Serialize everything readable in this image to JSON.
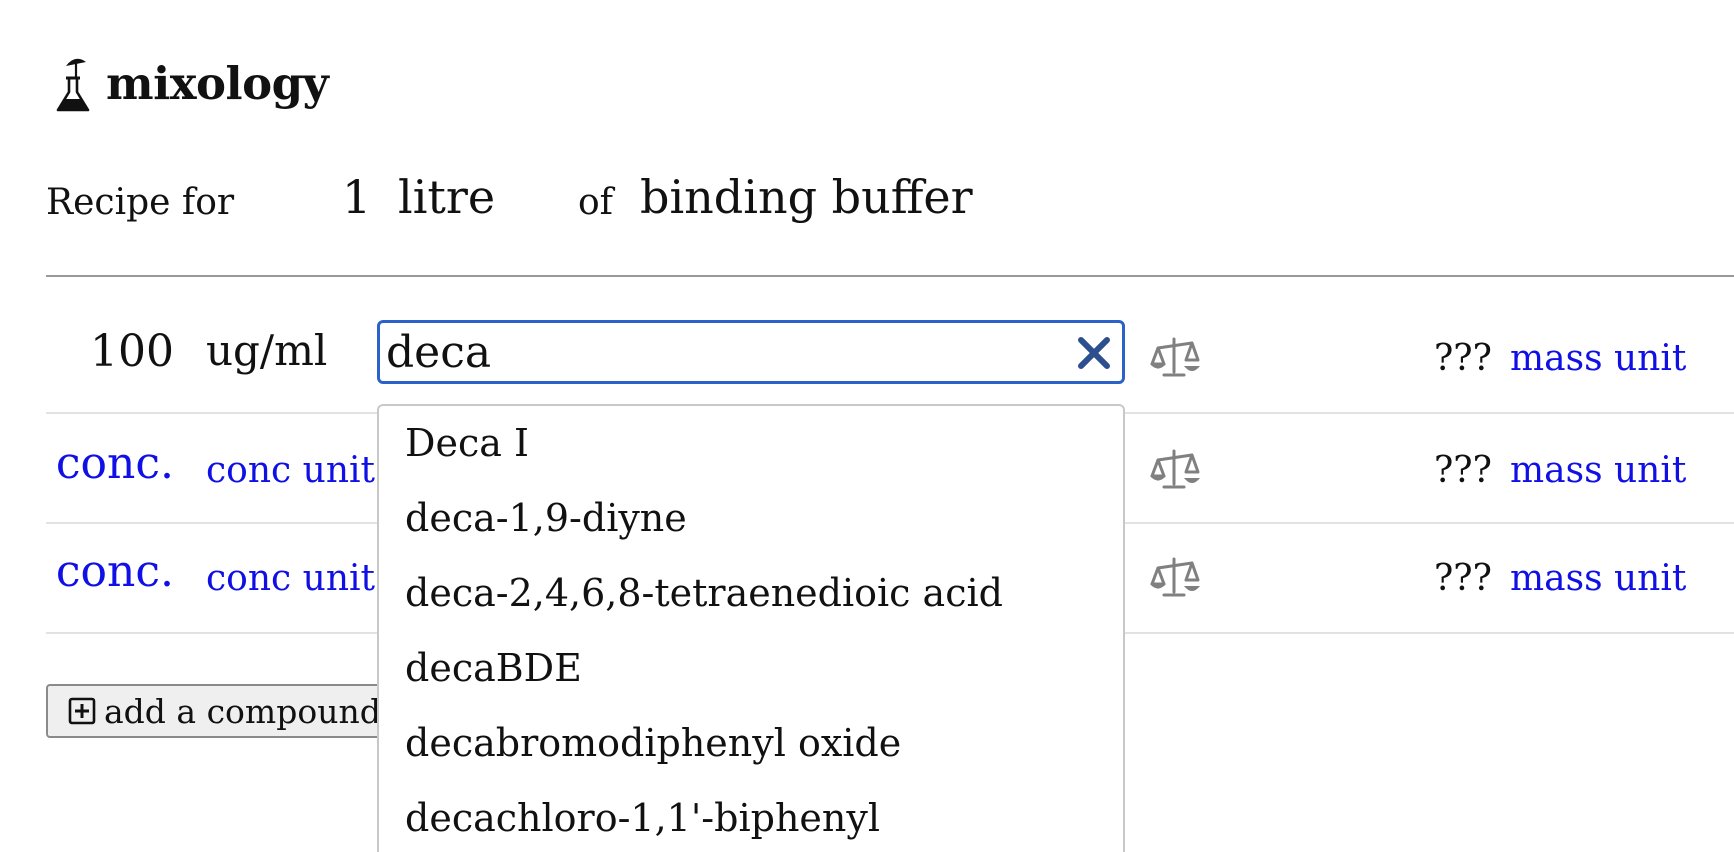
{
  "app": {
    "name": "mixology",
    "icon": "flask-umbrella-icon"
  },
  "recipe": {
    "prefix": "Recipe for",
    "quantity": "1",
    "unit": "litre",
    "of_label": "of",
    "name": "binding buffer"
  },
  "compounds": [
    {
      "conc_value": "100",
      "conc_unit": "ug/ml",
      "search_value": "deca",
      "weigh_icon": "balance-scale-icon",
      "mass_value": "???",
      "mass_unit": "mass unit"
    },
    {
      "conc_value": "conc.",
      "conc_unit": "conc unit",
      "weigh_icon": "balance-scale-icon",
      "mass_value": "???",
      "mass_unit": "mass unit"
    },
    {
      "conc_value": "conc.",
      "conc_unit": "conc unit",
      "weigh_icon": "balance-scale-icon",
      "mass_value": "???",
      "mass_unit": "mass unit"
    }
  ],
  "dropdown": {
    "options": [
      "Deca I",
      "deca-1,9-diyne",
      "deca-2,4,6,8-tetraenedioic acid",
      "decaBDE",
      "decabromodiphenyl oxide",
      "decachloro-1,1'-biphenyl"
    ]
  },
  "add_button": {
    "label": "add a compound",
    "icon": "plus-square-icon"
  },
  "colors": {
    "link": "#1010e6",
    "focus_border": "#2b62c9",
    "clear_icon": "#2d4f8f",
    "icon_gray": "#808080"
  }
}
